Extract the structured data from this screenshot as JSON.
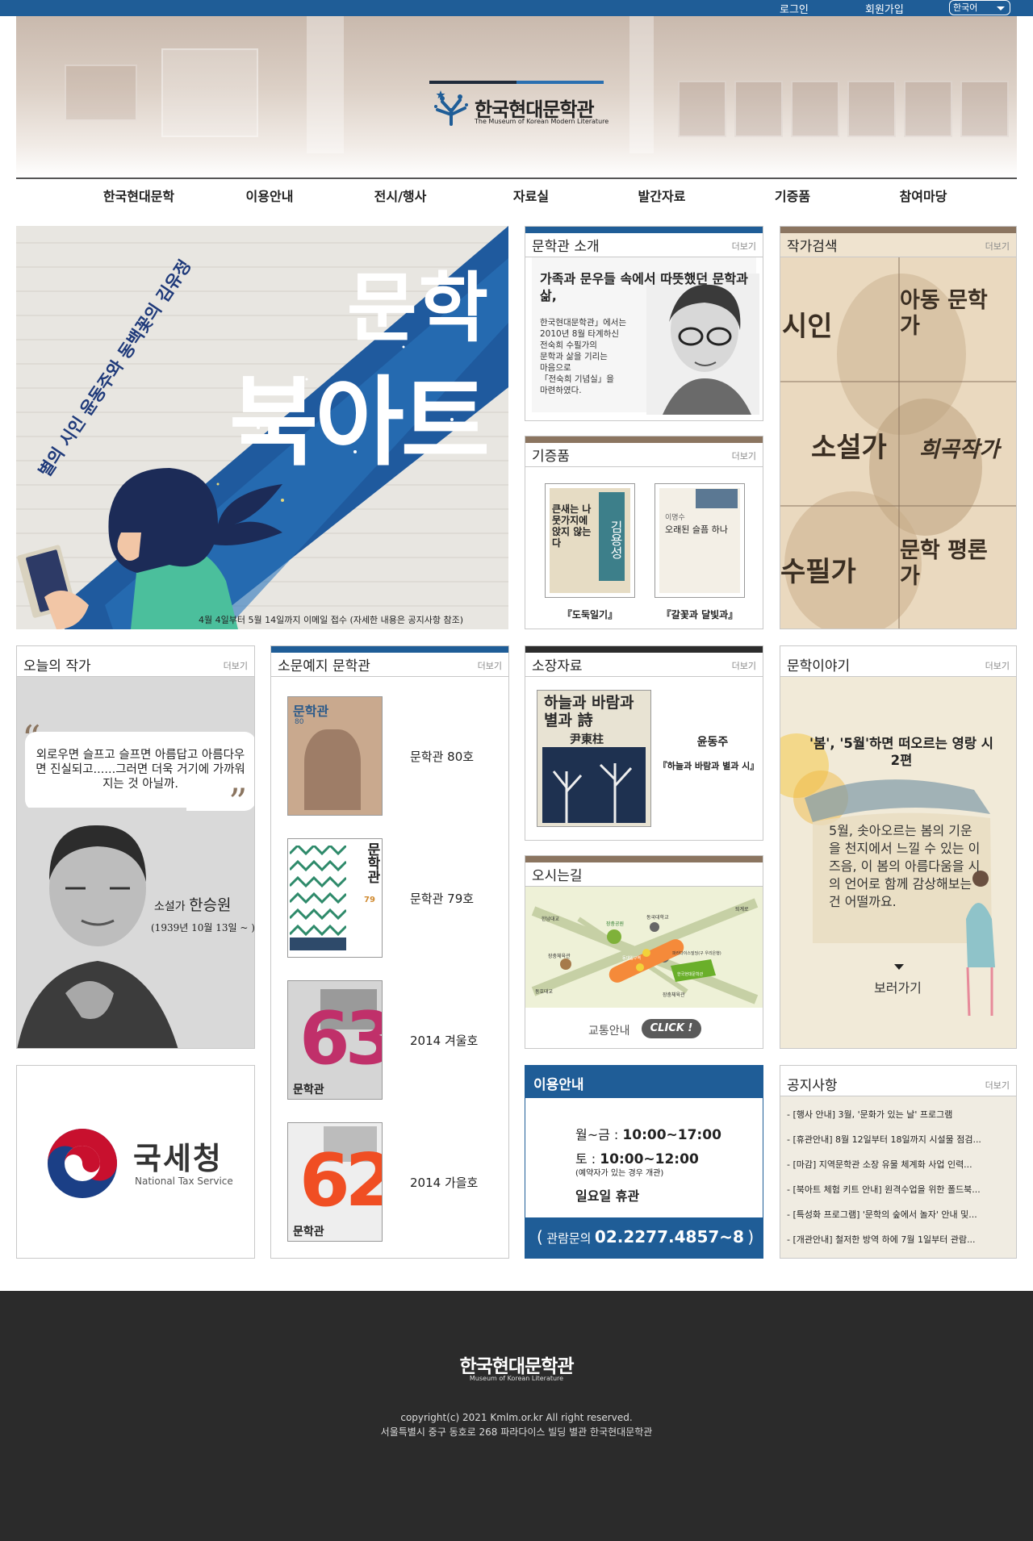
{
  "topbar": {
    "login": "로그인",
    "signup": "회원가입",
    "language": "한국어"
  },
  "header": {
    "logo_name": "한국현대문학관",
    "logo_sub": "The Museum of Korean Modern Literature"
  },
  "nav": [
    "한국현대문학",
    "이용안내",
    "전시/행사",
    "자료실",
    "발간자료",
    "기증품",
    "참여마당"
  ],
  "banner": {
    "title_line1": "문학",
    "title_line2": "북아트",
    "vertical_text": "별의 시인 윤동주와 동백꽃의 김유정",
    "caption": "4월 4일부터 5월 14일까지 이메일 접수 (자세한 내용은 공지사항 참조)"
  },
  "intro": {
    "title": "문학관 소개",
    "more": "더보기",
    "headline": "가족과 문우들 속에서 따뜻했던 문학과 삶,",
    "body": [
      "한국현대문학관」에서는",
      "2010년 8월 타계하신",
      "전숙희 수필가의",
      "문학과 삶을 기리는",
      "마음으로",
      "「전숙희 기념실」을",
      "마련하였다."
    ]
  },
  "donation": {
    "title": "기증품",
    "more": "더보기",
    "items": [
      {
        "caption": "『도둑일기』",
        "cover_title": "큰새는 나뭇가지에 앉지 않는다",
        "cover_author": "김용성"
      },
      {
        "caption": "『갈꽃과 달빛과』",
        "cover_title": "오래된 슬픔 하나",
        "cover_author": "이명수"
      }
    ]
  },
  "author_search": {
    "title": "작가검색",
    "more": "더보기",
    "cells": [
      "시인",
      "아동 문학가",
      "소설가",
      "희곡작가",
      "수필가",
      "문학 평론가"
    ]
  },
  "today_author": {
    "title": "오늘의 작가",
    "more": "더보기",
    "quote": "외로우면 슬프고 슬프면 아름답고 아름다우면 진실되고......그러면 더욱 거기에 가까워지는 것 아닐까.",
    "role": "소설가",
    "name": "한승원",
    "dates": "(1939년 10월 13일 ~ )"
  },
  "nts": {
    "name": "국세청",
    "sub": "National Tax Service"
  },
  "magazine": {
    "title": "소문예지 문학관",
    "more": "더보기",
    "items": [
      {
        "label": "문학관 80호",
        "cover": "문학관",
        "num": "80"
      },
      {
        "label": "문학관 79호",
        "cover": "문학관",
        "num": "79"
      },
      {
        "label": "2014 겨울호",
        "cover": "문학관",
        "num": "63"
      },
      {
        "label": "2014 가을호",
        "cover": "문학관",
        "num": "62"
      }
    ]
  },
  "collection": {
    "title": "소장자료",
    "more": "더보기",
    "author": "윤동주",
    "work": "『하늘과 바람과 별과 시』",
    "cover_title": "하늘과 바람과 별과 詩",
    "cover_author": "尹東柱"
  },
  "directions": {
    "title": "오시는길",
    "traffic": "교통안내",
    "click": "CLICK !",
    "map_labels": [
      "한남대교",
      "장충공원",
      "동국대학교",
      "퇴계로",
      "장충체육관",
      "동대입구역",
      "파라다이스빌딩(구 우리은행)",
      "한국현대문학관",
      "동호대교",
      "장충체육관"
    ]
  },
  "story": {
    "title": "문학이야기",
    "more": "더보기",
    "headline": "'봄', '5월'하면 떠오르는 영랑 시 2편",
    "body": "5월, 솟아오르는 봄의 기운을 천지에서 느낄 수 있는 이 즈음, 이 봄의 아름다움을 시의 언어로 함께 감상해보는 건 어떨까요.",
    "go": "보러가기"
  },
  "usage": {
    "title": "이용안내",
    "weekday": "월~금 : ",
    "weekday_time": "10:00~17:00",
    "saturday": "토 : ",
    "saturday_time": "10:00~12:00",
    "saturday_note": "(예약자가 있는 경우 개관)",
    "sunday": "일요일 휴관",
    "phone_label": "관람문의",
    "phone": "02.2277.4857~8",
    "paren_open": "(",
    "paren_close": ")"
  },
  "notice": {
    "title": "공지사항",
    "more": "더보기",
    "items": [
      "- [행사 안내] 3월, '문화가 있는 날' 프로그램",
      "- [휴관안내] 8월 12일부터 18일까지 시설물 점검...",
      "- [마감] 지역문학관 소장 유물 체계화 사업 인력...",
      "- [북아트 체험 키트 안내] 원격수업을 위한 폴드북...",
      "- [특성화 프로그램] '문학의 숲에서 놀자' 안내 및...",
      "- [개관안내] 철저한 방역 하에 7월 1일부터 관람..."
    ]
  },
  "footer": {
    "logo": "한국현대문학관",
    "logo_sub": "Museum of Korean Literature",
    "copyright": "copyright(c) 2021 Kmlm.or.kr All right reserved.",
    "address": "서울특별시 중구 동호로 268 파라다이스 빌딩 별관 한국현대문학관"
  },
  "colors": {
    "brand_blue": "#1f5d97",
    "brown": "#8b7560",
    "dark": "#2b2b2b"
  }
}
